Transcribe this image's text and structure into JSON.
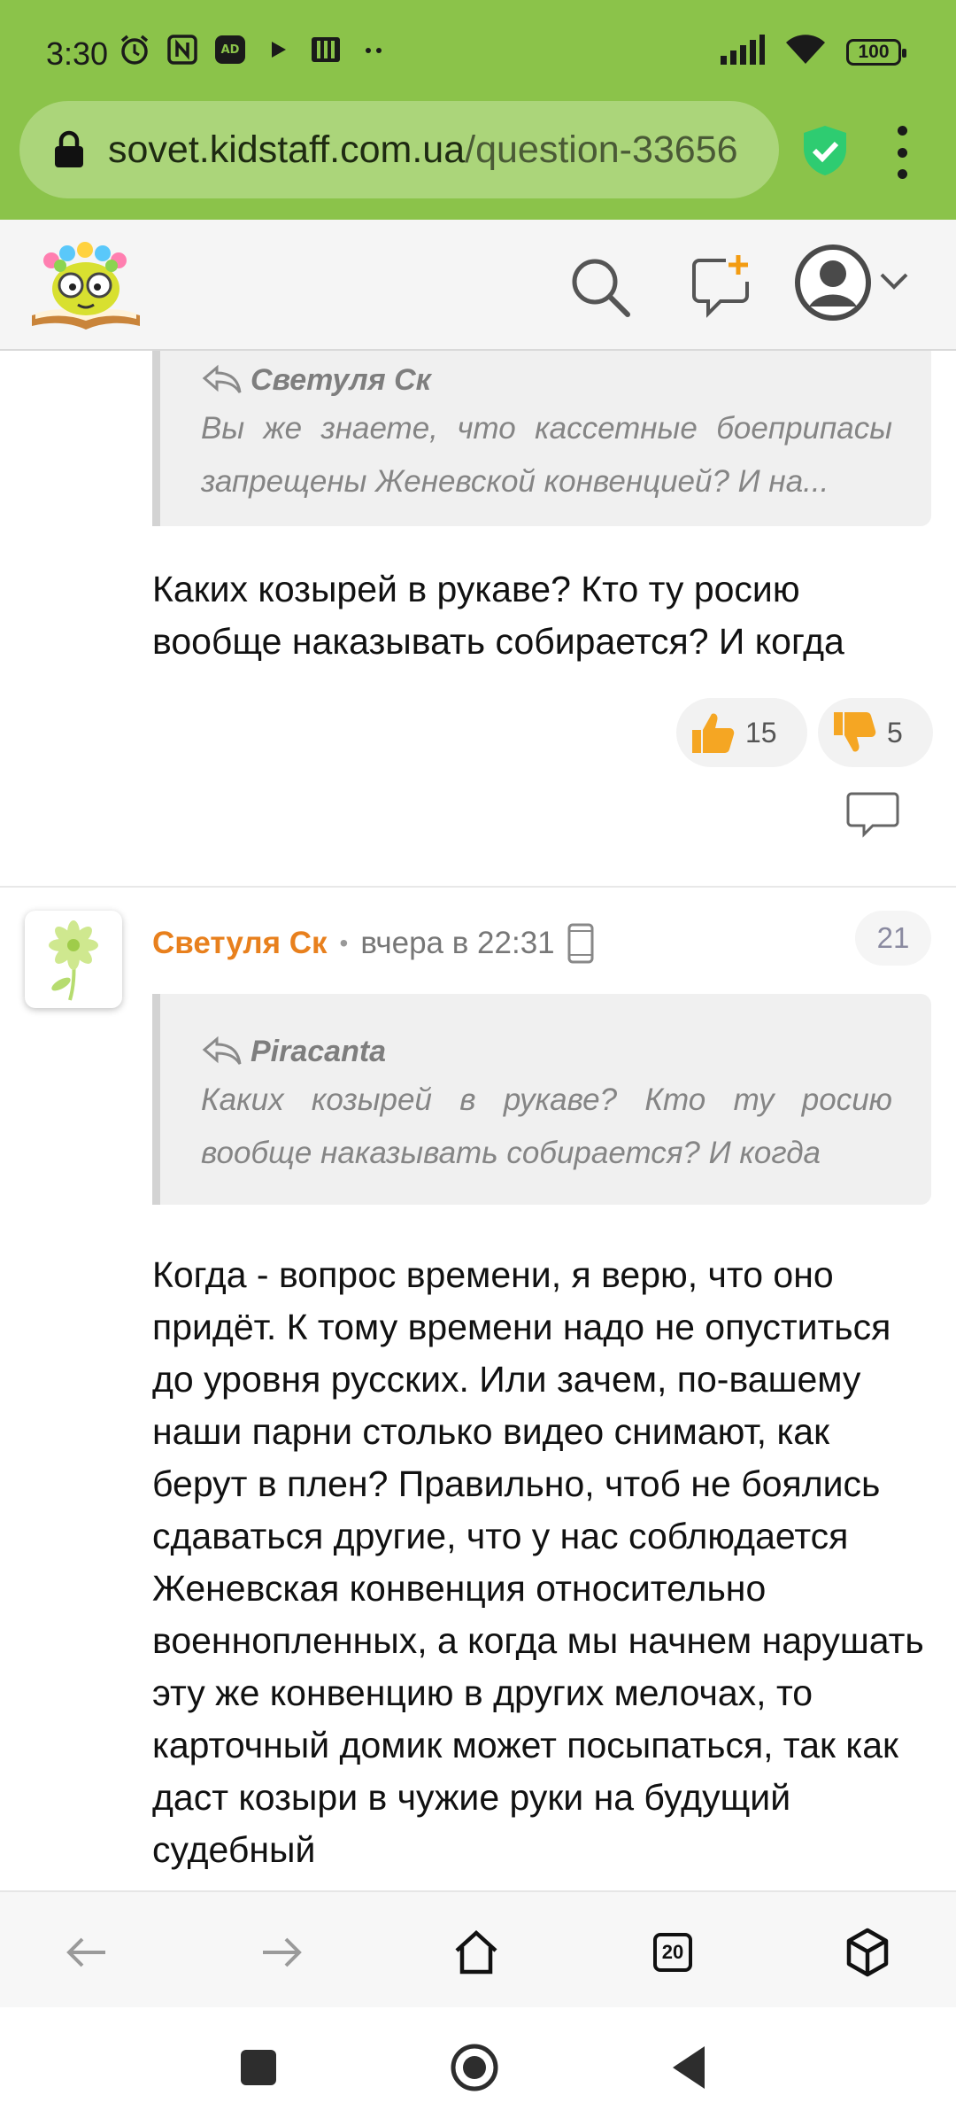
{
  "status_bar": {
    "time": "3:30",
    "battery": "100",
    "icons_left": [
      "alarm-icon",
      "nfc-icon",
      "ad-icon",
      "play-icon",
      "media-icon",
      "more-dots-icon"
    ],
    "icons_right": [
      "signal-icon",
      "wifi-icon",
      "battery-icon"
    ]
  },
  "browser": {
    "url_host": "sovet.kidstaff.com.ua",
    "url_path": "/question-33656",
    "icons": [
      "lock-icon",
      "shield-check-icon",
      "menu-dots-icon"
    ]
  },
  "site_header": {
    "icons": [
      "logo",
      "search-icon",
      "new-post-icon",
      "avatar-icon",
      "chevron-down-icon"
    ]
  },
  "post1": {
    "quote_author": "Светуля Ск",
    "quote_text": "Вы же знаете, что кассетные боеприпасы запрещены Женевской конвенцией? И на...",
    "text": "Каких козырей в рукаве? Кто ту росию вообще наказывать собирается? И когда",
    "likes": "15",
    "dislikes": "5"
  },
  "comment": {
    "author": "Светуля Ск",
    "separator": "•",
    "time": "вчера в 22:31",
    "number": "21",
    "quote_author": "Piracanta",
    "quote_text": "Каких козырей в рукаве? Кто ту росию вообще наказывать собирается? И когда",
    "text": "Когда - вопрос времени, я верю, что оно придёт. К тому времени надо не опуститься до уровня русских. Или зачем, по-вашему наши парни столько видео снимают, как берут в плен? Правильно, чтоб не боялись сдаваться другие, что у нас соблюдается Женевская конвенция относительно военнопленных, а когда мы начнем нарушать эту же конвенцию в других мелочах, то карточный домик может посыпаться, так как даст козыри в чужие руки на будущий судебный"
  },
  "toolbar": {
    "tabs_count": "20",
    "icons": [
      "back-icon",
      "forward-icon",
      "home-icon",
      "tabs-icon",
      "extensions-icon"
    ]
  },
  "system_nav": {
    "icons": [
      "recents-icon",
      "home-nav-icon",
      "back-nav-icon"
    ]
  },
  "colors": {
    "browser_bar": "#8bc34a",
    "url_pill": "#abd57a",
    "author_orange": "#e8801d",
    "shield_green": "#2ecc71"
  }
}
